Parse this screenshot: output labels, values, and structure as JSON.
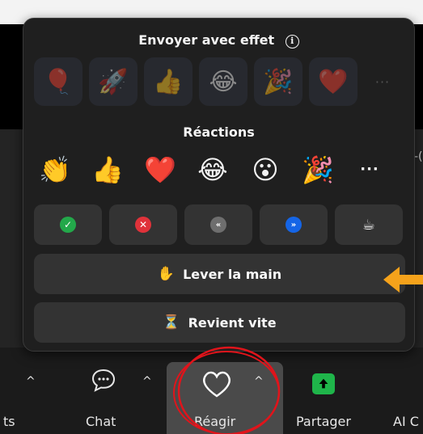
{
  "popup": {
    "effects_title": "Envoyer avec effet",
    "info_icon": "ⓘ",
    "effects": [
      "🎈",
      "🚀",
      "👍",
      "😂",
      "🎉",
      "❤️"
    ],
    "effects_more": "···",
    "reactions_title": "Réactions",
    "reactions": [
      "👏",
      "👍",
      "❤️",
      "😂",
      "😮",
      "🎉"
    ],
    "reactions_more": "···",
    "status_buttons": [
      {
        "name": "yes",
        "glyph": "✓",
        "color": "#23a84a"
      },
      {
        "name": "no",
        "glyph": "✕",
        "color": "#e0323a"
      },
      {
        "name": "slower",
        "glyph": "«",
        "color": "#6e6e6e"
      },
      {
        "name": "faster",
        "glyph": "»",
        "color": "#1565e6"
      },
      {
        "name": "coffee",
        "glyph": "☕",
        "color": "#333333"
      }
    ],
    "raise_hand_icon": "✋",
    "raise_hand_label": "Lever la main",
    "be_right_back_icon": "⏳",
    "be_right_back_label": "Revient vite"
  },
  "annotation": {
    "arrow_color": "#f5a21b",
    "circle_color": "#e0141b"
  },
  "toolbar": {
    "left_partial": "ts",
    "chat_label": "Chat",
    "react_label": "Réagir",
    "share_label": "Partager",
    "ai_partial": "AI C"
  },
  "edge_partial_text": "-("
}
